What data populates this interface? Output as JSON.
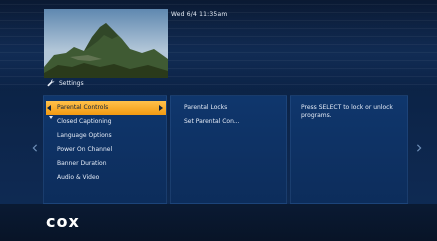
{
  "datetime": "Wed 6/4  11:35am",
  "section": {
    "title": "Settings",
    "icon": "wrench-icon"
  },
  "menu": {
    "items": [
      {
        "label": "Parental Controls",
        "selected": true
      },
      {
        "label": "Closed Captioning",
        "selected": false
      },
      {
        "label": "Language Options",
        "selected": false
      },
      {
        "label": "Power On Channel",
        "selected": false
      },
      {
        "label": "Banner Duration",
        "selected": false
      },
      {
        "label": "Audio & Video",
        "selected": false
      }
    ]
  },
  "submenu": {
    "items": [
      {
        "label": "Parental Locks"
      },
      {
        "label": "Set Parental Con..."
      }
    ]
  },
  "help": {
    "text": "Press SELECT to lock or unlock programs."
  },
  "brand": {
    "logo_text": "cox"
  },
  "colors": {
    "highlight": "#f7a51c",
    "background": "#0c2346",
    "panel": "#0f376e",
    "text": "#e6edf8"
  },
  "icons": {
    "left_nav": "chevron-left-icon",
    "right_nav": "chevron-right-icon"
  }
}
